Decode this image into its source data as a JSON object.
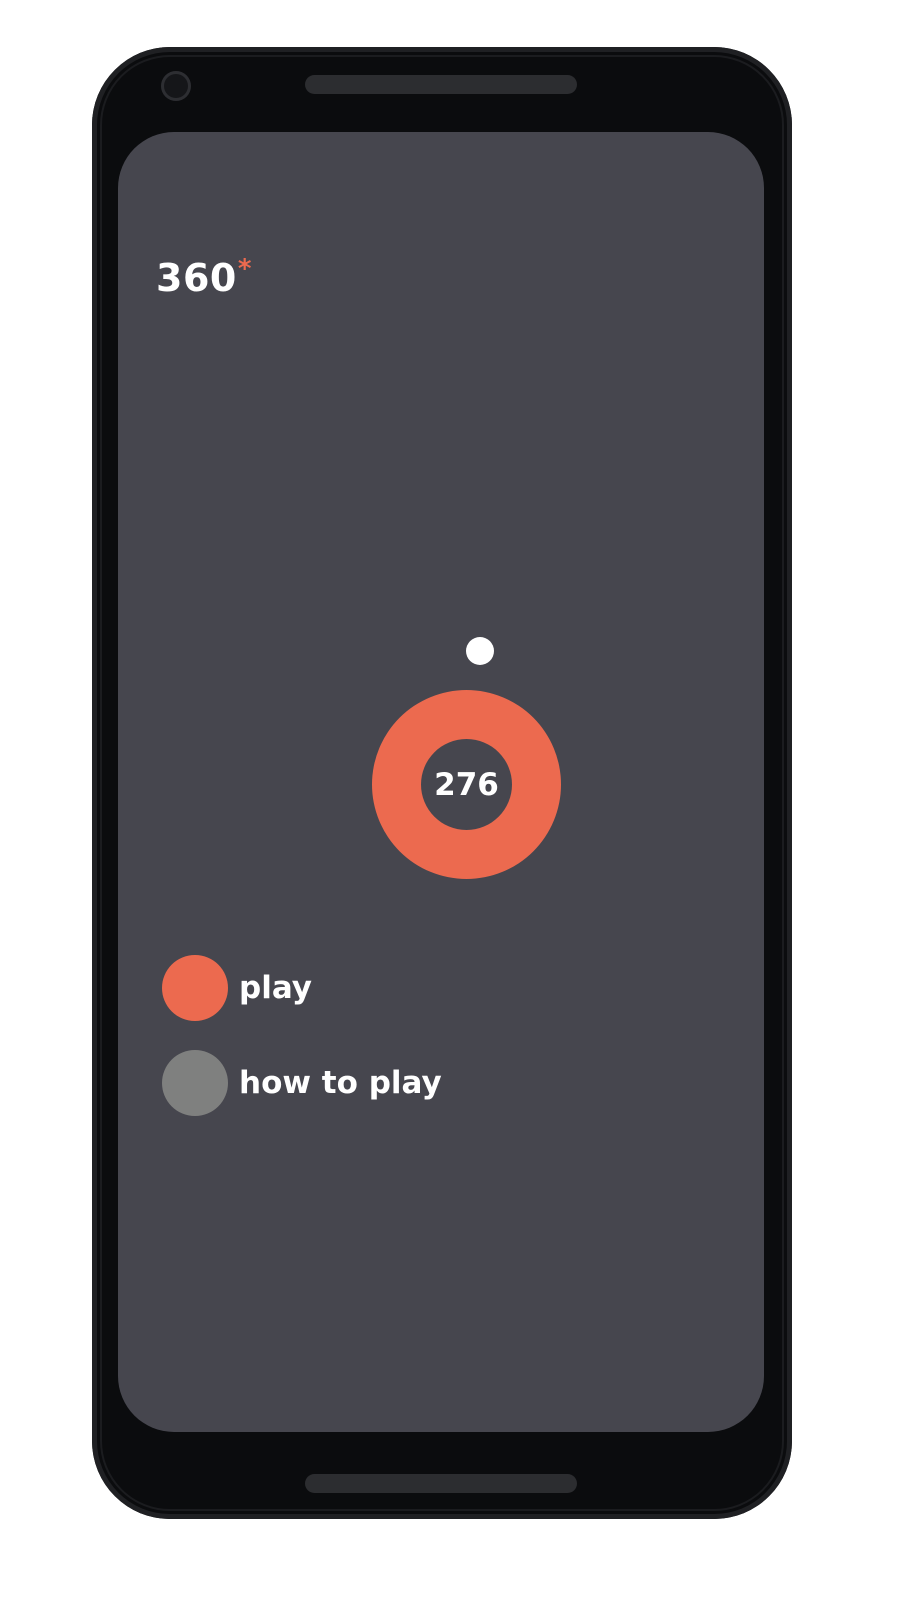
{
  "game": {
    "score_label": "360",
    "score_mark": "*",
    "ring_value": "276"
  },
  "menu": {
    "play_label": "play",
    "how_to_play_label": "how to play"
  },
  "colors": {
    "accent": "#ec6a4f",
    "screen_background": "#46464e",
    "secondary_button": "#7f807f",
    "text": "#ffffff"
  }
}
